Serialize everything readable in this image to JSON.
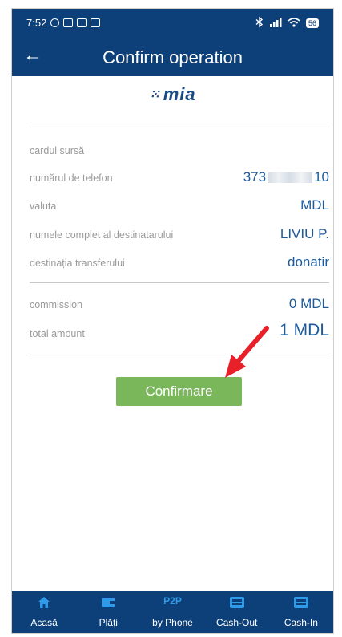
{
  "status_bar": {
    "time": "7:52",
    "battery": "56"
  },
  "header": {
    "title": "Confirm operation"
  },
  "logo": {
    "text": "mia"
  },
  "details": {
    "source_card_label": "cardul sursă",
    "phone_label": "numărul de telefon",
    "phone_prefix": "373",
    "phone_suffix": "10",
    "currency_label": "valuta",
    "currency_value": "MDL",
    "recipient_label": "numele complet al destinatarului",
    "recipient_value": "LIVIU P.",
    "purpose_label": "destinația transferului",
    "purpose_value": "donatir"
  },
  "totals": {
    "commission_label": "commission",
    "commission_value": "0 MDL",
    "total_label": "total amount",
    "total_value": "1 MDL"
  },
  "confirm_button": "Confirmare",
  "bottom_nav": {
    "home": "Acasă",
    "payments": "Plăți",
    "p2p_badge": "P2P",
    "by_phone": "by Phone",
    "cash_out": "Cash-Out",
    "cash_in": "Cash-In"
  },
  "colors": {
    "primary": "#0d3f78",
    "accent_text": "#1e5a9a",
    "button": "#7ab75a",
    "annotation": "#e8202a"
  }
}
